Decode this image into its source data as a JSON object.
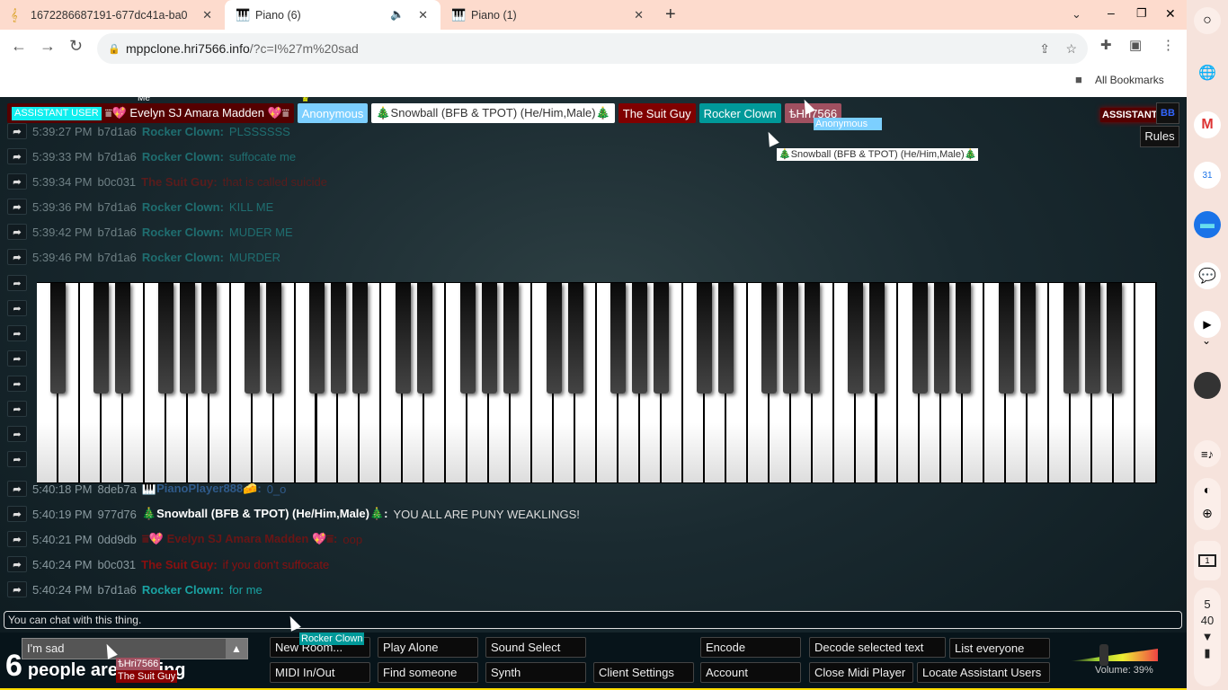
{
  "browser": {
    "tabs": [
      {
        "title": "1672286687191-677dc41a-ba0",
        "icon": "music-note-icon",
        "active": false
      },
      {
        "title": "Piano (6)",
        "icon": "piano-icon",
        "active": true,
        "audio": true
      },
      {
        "title": "Piano (1)",
        "icon": "piano-icon",
        "active": false
      }
    ],
    "url_host": "mppclone.hri7566.info",
    "url_path": "/?c=I%27m%20sad",
    "bookmarks_label": "All Bookmarks"
  },
  "users": {
    "assistant_tag": "ASSISTANT USER",
    "me_label": "Me",
    "list": [
      {
        "name": "⩸💖 Evelyn SJ Amara Madden 💖⩸",
        "color": "#550000"
      },
      {
        "name": "Anonymous",
        "color": "#7ccfff",
        "crown": true
      },
      {
        "name": "🎄Snowball (BFB & TPOT) (He/Him,Male)🎄",
        "color": "#ffffff",
        "text": "#333"
      },
      {
        "name": "The Suit Guy",
        "color": "#800000"
      },
      {
        "name": "Rocker Clown",
        "color": "#009999"
      },
      {
        "name": "ѣHri7566",
        "color": "#a05060"
      }
    ],
    "top_right": {
      "assistant": "ASSISTANT",
      "bb": "BB",
      "rules": "Rules"
    }
  },
  "chat": {
    "messages_top": [
      {
        "time": "5:39:27 PM",
        "id": "b7d1a6",
        "name": "Rocker Clown:",
        "text": "PLSSSSSS",
        "color": "#1f6e70"
      },
      {
        "time": "5:39:33 PM",
        "id": "b7d1a6",
        "name": "Rocker Clown:",
        "text": "suffocate me",
        "color": "#1f6e70"
      },
      {
        "time": "5:39:34 PM",
        "id": "b0c031",
        "name": "The Suit Guy:",
        "text": "that is called suicide",
        "color": "#5a1c1c"
      },
      {
        "time": "5:39:36 PM",
        "id": "b7d1a6",
        "name": "Rocker Clown:",
        "text": "KILL ME",
        "color": "#1f6e70"
      },
      {
        "time": "5:39:42 PM",
        "id": "b7d1a6",
        "name": "Rocker Clown:",
        "text": "MUDER ME",
        "color": "#1f6e70"
      },
      {
        "time": "5:39:46 PM",
        "id": "b7d1a6",
        "name": "Rocker Clown:",
        "text": "MURDER",
        "color": "#1f6e70"
      }
    ],
    "messages_bottom": [
      {
        "time": "5:40:18 PM",
        "id": "8deb7a",
        "name": "🎹PianoPlayer888🧀:",
        "text": "0_o",
        "color": "#2f5a8a"
      },
      {
        "time": "5:40:19 PM",
        "id": "977d76",
        "name": "🎄Snowball (BFB & TPOT) (He/Him,Male)🎄:",
        "text": "YOU ALL ARE PUNY WEAKLINGS!",
        "color": "#ffffff",
        "textcolor": "#dddddd"
      },
      {
        "time": "5:40:21 PM",
        "id": "0dd9db",
        "name": "⩸💖 Evelyn SJ Amara Madden 💖⩸:",
        "text": "oop",
        "color": "#6a1515"
      },
      {
        "time": "5:40:24 PM",
        "id": "b0c031",
        "name": "The Suit Guy:",
        "text": "if you don't suffocate",
        "color": "#8a1010"
      },
      {
        "time": "5:40:24 PM",
        "id": "b7d1a6",
        "name": "Rocker Clown:",
        "text": "for me",
        "color": "#1aa3a3"
      }
    ],
    "input_placeholder": "You can chat with this thing."
  },
  "bottom": {
    "room": "I'm sad",
    "count": "6",
    "count_text": "people are playing",
    "buttons": [
      "New Room...",
      "Play Alone",
      "Sound Select",
      "MIDI In/Out",
      "Find someone",
      "Synth",
      "Client Settings",
      "Encode",
      "Decode selected text",
      "List everyone",
      "Account",
      "Close Midi Player",
      "Locate Assistant Users"
    ],
    "volume_label": "Volume: 39%",
    "volume": 0.39
  },
  "cursors": {
    "snowball": "🎄Snowball (BFB & TPOT) (He/Him,Male)🎄",
    "anon": "Anonymous",
    "rocker": "Rocker Clown",
    "hri": "ѣHri7566",
    "suit": "The Suit Guy"
  },
  "shelf": {
    "time_h": "5",
    "time_m": "40",
    "date": "1"
  }
}
